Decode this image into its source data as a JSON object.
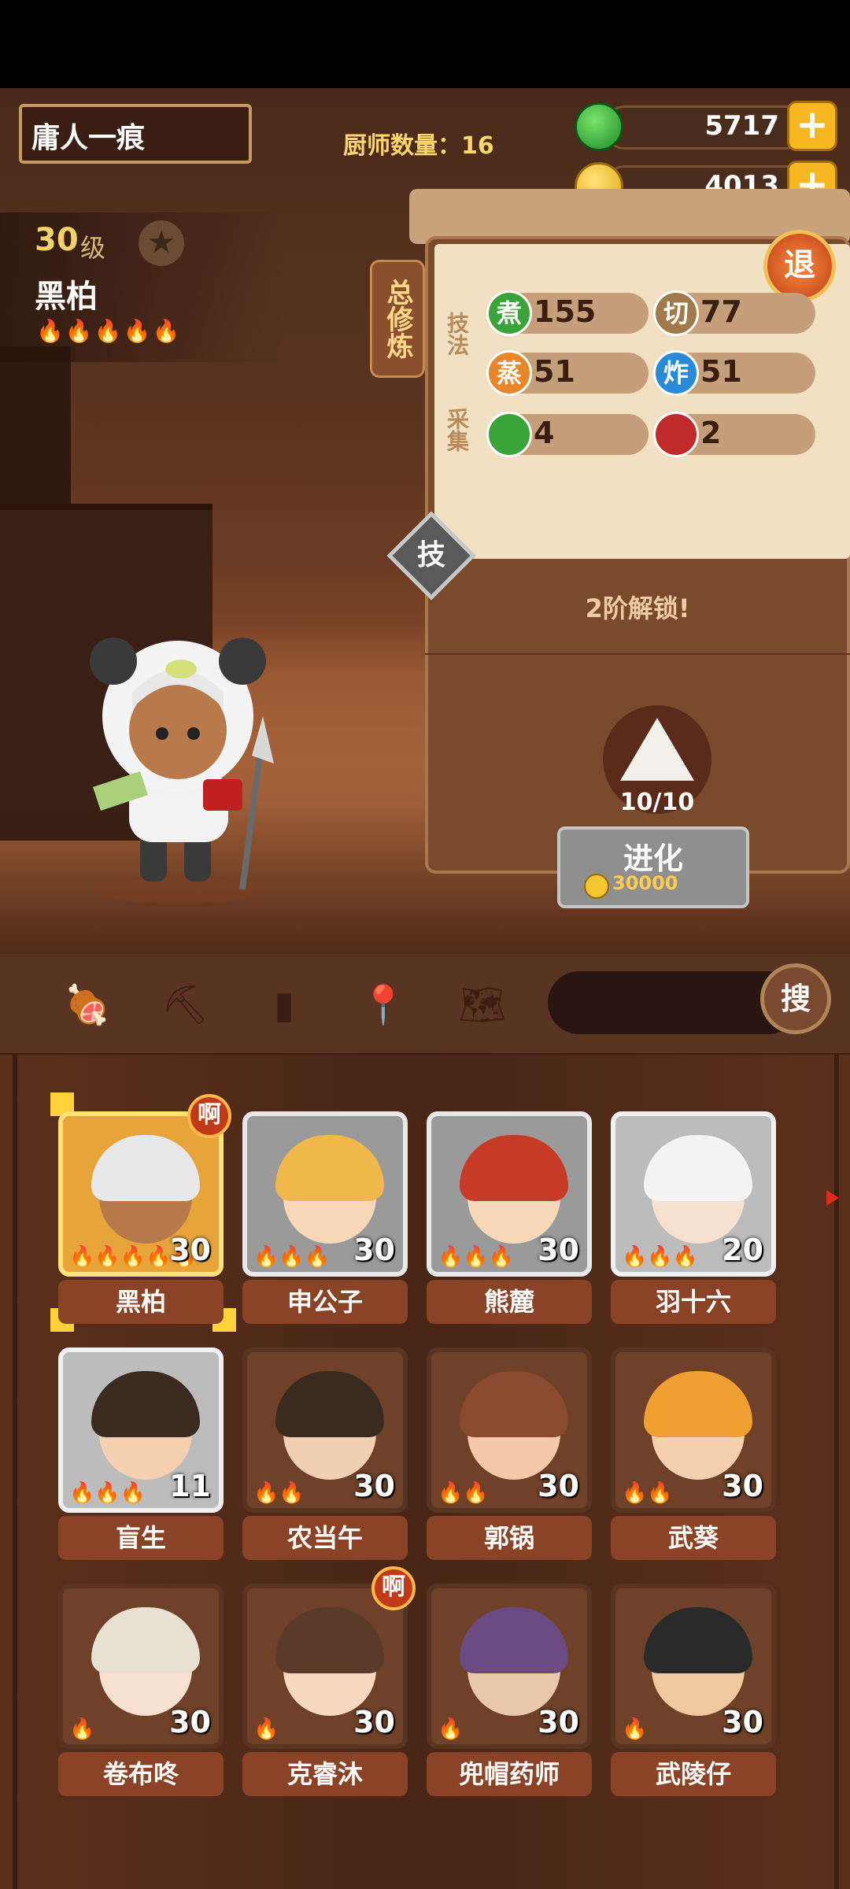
{
  "header": {
    "player_name": "庸人一痕",
    "chef_count": "厨师数量：16",
    "jade": "5717",
    "coins": "4013"
  },
  "chef": {
    "level_num": "30",
    "level_unit": "级",
    "name": "黑柏",
    "flames": "🔥🔥🔥🔥🔥"
  },
  "panel": {
    "tab_label": "总修炼",
    "exit_label": "退",
    "skill_group_label": "技法",
    "gather_group_label": "采集",
    "skills": [
      {
        "icon": "煮",
        "value": "155",
        "color": "#3aa43a"
      },
      {
        "icon": "切",
        "value": "77",
        "color": "#a07a4a"
      },
      {
        "icon": "蒸",
        "value": "51",
        "color": "#e8862a"
      },
      {
        "icon": "炸",
        "value": "51",
        "color": "#2a8ad8"
      },
      {
        "icon": "菜",
        "value": "4",
        "color": "#3aa43a"
      },
      {
        "icon": "肉",
        "value": "2",
        "color": "#c02a2a"
      }
    ],
    "skill_button": "技",
    "unlock_text": "2阶解锁!",
    "gem_count": "10/10",
    "evolve_label": "进化",
    "evolve_cost": "30000"
  },
  "toolbar": {
    "search_label": "搜"
  },
  "cards": [
    {
      "name": "黑柏",
      "level": "30",
      "flames": "🔥🔥🔥🔥🔥",
      "style": "gold",
      "badge": "啊"
    },
    {
      "name": "申公子",
      "level": "30",
      "flames": "🔥🔥🔥",
      "style": "grey",
      "badge": ""
    },
    {
      "name": "熊麓",
      "level": "30",
      "flames": "🔥🔥🔥",
      "style": "grey",
      "badge": ""
    },
    {
      "name": "羽十六",
      "level": "20",
      "flames": "🔥🔥🔥",
      "style": "white",
      "badge": ""
    },
    {
      "name": "盲生",
      "level": "11",
      "flames": "🔥🔥🔥",
      "style": "white",
      "badge": ""
    },
    {
      "name": "农当午",
      "level": "30",
      "flames": "🔥🔥",
      "style": "brown",
      "badge": ""
    },
    {
      "name": "郭锅",
      "level": "30",
      "flames": "🔥🔥",
      "style": "brown",
      "badge": ""
    },
    {
      "name": "武葵",
      "level": "30",
      "flames": "🔥🔥",
      "style": "brown",
      "badge": ""
    },
    {
      "name": "卷布咚",
      "level": "30",
      "flames": "🔥",
      "style": "brown",
      "badge": ""
    },
    {
      "name": "克睿沐",
      "level": "30",
      "flames": "🔥",
      "style": "brown",
      "badge": "啊"
    },
    {
      "name": "兜帽药师",
      "level": "30",
      "flames": "🔥",
      "style": "brown",
      "badge": ""
    },
    {
      "name": "武陵仔",
      "level": "30",
      "flames": "🔥",
      "style": "brown",
      "badge": ""
    }
  ]
}
